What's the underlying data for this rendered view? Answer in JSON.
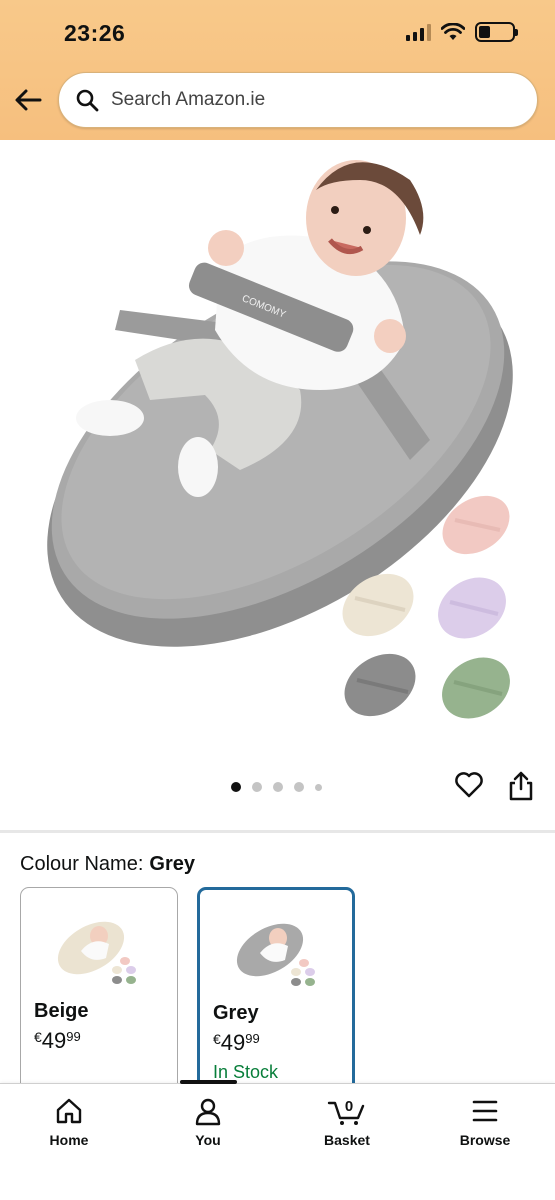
{
  "status_bar": {
    "time": "23:26"
  },
  "search": {
    "placeholder": "Search Amazon.ie"
  },
  "icons": {
    "back": "arrow-left-icon",
    "search": "search-icon",
    "favourite": "heart-icon",
    "share": "share-icon",
    "home": "home-icon",
    "you": "person-icon",
    "basket": "basket-icon",
    "browse": "menu-icon"
  },
  "carousel": {
    "total": 5,
    "active": 1
  },
  "product": {
    "brand_logo_text": "COMOMY"
  },
  "colour": {
    "label": "Colour Name:",
    "selected": "Grey",
    "options": [
      {
        "name": "Beige",
        "currency": "€",
        "price_whole": "49",
        "price_cents": "99",
        "stock": ""
      },
      {
        "name": "Grey",
        "currency": "€",
        "price_whole": "49",
        "price_cents": "99",
        "stock": "In Stock"
      }
    ]
  },
  "bottom_nav": {
    "items": [
      {
        "label": "Home"
      },
      {
        "label": "You"
      },
      {
        "label": "Basket",
        "badge": "0"
      },
      {
        "label": "Browse"
      }
    ]
  },
  "colors": {
    "header": "#f7c585",
    "selected_border": "#236a9b",
    "in_stock": "#087e3a",
    "mattress_grey": "#a6a6a6",
    "variant_pink": "#f2c9c3",
    "variant_beige": "#ede5d4",
    "variant_lilac": "#dccdea",
    "variant_grey": "#8c8c8c",
    "variant_green": "#96b38e"
  }
}
